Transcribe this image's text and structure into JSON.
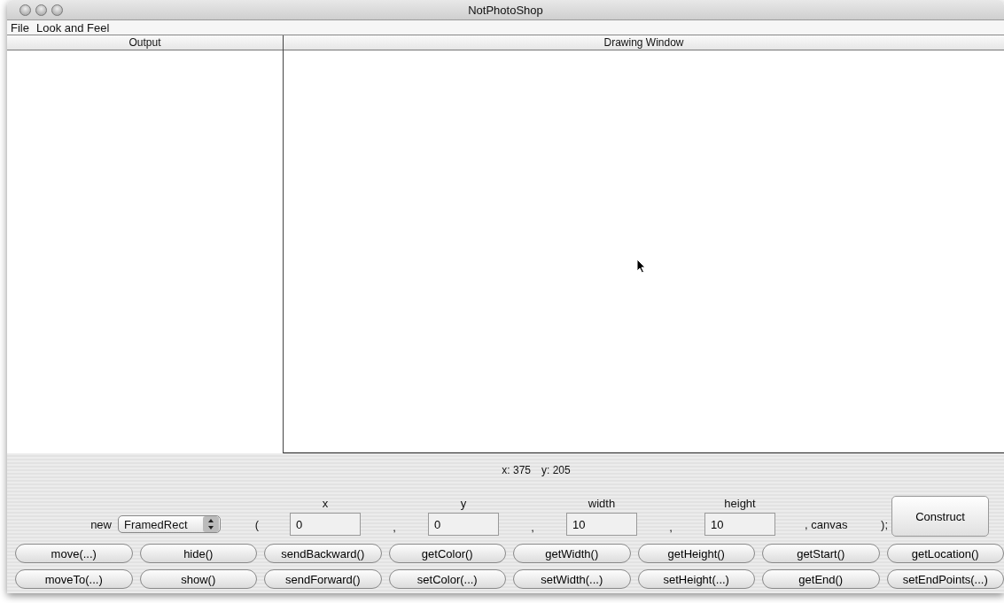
{
  "window": {
    "title": "NotPhotoShop"
  },
  "menu": [
    "File",
    "Look and Feel"
  ],
  "panes": [
    {
      "header": "Output"
    },
    {
      "header": "Drawing Window"
    }
  ],
  "coordinates": {
    "x": "x: 375",
    "y": "y: 205"
  },
  "constructor": {
    "new_label": "new",
    "shape": "FramedRect",
    "open_paren": "(",
    "params": [
      {
        "label": "x",
        "value": "0"
      },
      {
        "label": "y",
        "value": "0"
      },
      {
        "label": "width",
        "value": "10"
      },
      {
        "label": "height",
        "value": "10"
      }
    ],
    "separator": ",",
    "canvas": ", canvas",
    "close": ");",
    "button": "Construct"
  },
  "method_rows": [
    [
      "move(...)",
      "hide()",
      "sendBackward()",
      "getColor()",
      "getWidth()",
      "getHeight()",
      "getStart()",
      "getLocation()"
    ],
    [
      "moveTo(...)",
      "show()",
      "sendForward()",
      "setColor(...)",
      "setWidth(...)",
      "setHeight(...)",
      "getEnd()",
      "setEndPoints(...)"
    ]
  ]
}
